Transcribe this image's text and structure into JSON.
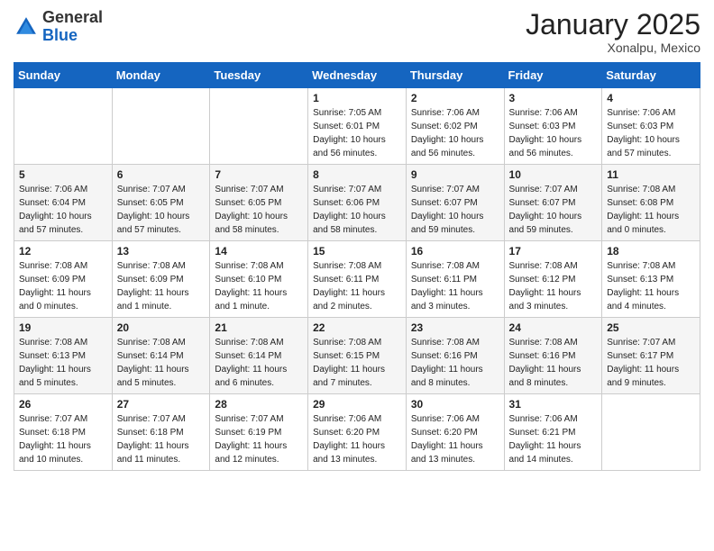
{
  "header": {
    "logo": {
      "line1": "General",
      "line2": "Blue"
    },
    "month": "January 2025",
    "location": "Xonalpu, Mexico"
  },
  "weekdays": [
    "Sunday",
    "Monday",
    "Tuesday",
    "Wednesday",
    "Thursday",
    "Friday",
    "Saturday"
  ],
  "weeks": [
    [
      {
        "day": "",
        "info": ""
      },
      {
        "day": "",
        "info": ""
      },
      {
        "day": "",
        "info": ""
      },
      {
        "day": "1",
        "info": "Sunrise: 7:05 AM\nSunset: 6:01 PM\nDaylight: 10 hours\nand 56 minutes."
      },
      {
        "day": "2",
        "info": "Sunrise: 7:06 AM\nSunset: 6:02 PM\nDaylight: 10 hours\nand 56 minutes."
      },
      {
        "day": "3",
        "info": "Sunrise: 7:06 AM\nSunset: 6:03 PM\nDaylight: 10 hours\nand 56 minutes."
      },
      {
        "day": "4",
        "info": "Sunrise: 7:06 AM\nSunset: 6:03 PM\nDaylight: 10 hours\nand 57 minutes."
      }
    ],
    [
      {
        "day": "5",
        "info": "Sunrise: 7:06 AM\nSunset: 6:04 PM\nDaylight: 10 hours\nand 57 minutes."
      },
      {
        "day": "6",
        "info": "Sunrise: 7:07 AM\nSunset: 6:05 PM\nDaylight: 10 hours\nand 57 minutes."
      },
      {
        "day": "7",
        "info": "Sunrise: 7:07 AM\nSunset: 6:05 PM\nDaylight: 10 hours\nand 58 minutes."
      },
      {
        "day": "8",
        "info": "Sunrise: 7:07 AM\nSunset: 6:06 PM\nDaylight: 10 hours\nand 58 minutes."
      },
      {
        "day": "9",
        "info": "Sunrise: 7:07 AM\nSunset: 6:07 PM\nDaylight: 10 hours\nand 59 minutes."
      },
      {
        "day": "10",
        "info": "Sunrise: 7:07 AM\nSunset: 6:07 PM\nDaylight: 10 hours\nand 59 minutes."
      },
      {
        "day": "11",
        "info": "Sunrise: 7:08 AM\nSunset: 6:08 PM\nDaylight: 11 hours\nand 0 minutes."
      }
    ],
    [
      {
        "day": "12",
        "info": "Sunrise: 7:08 AM\nSunset: 6:09 PM\nDaylight: 11 hours\nand 0 minutes."
      },
      {
        "day": "13",
        "info": "Sunrise: 7:08 AM\nSunset: 6:09 PM\nDaylight: 11 hours\nand 1 minute."
      },
      {
        "day": "14",
        "info": "Sunrise: 7:08 AM\nSunset: 6:10 PM\nDaylight: 11 hours\nand 1 minute."
      },
      {
        "day": "15",
        "info": "Sunrise: 7:08 AM\nSunset: 6:11 PM\nDaylight: 11 hours\nand 2 minutes."
      },
      {
        "day": "16",
        "info": "Sunrise: 7:08 AM\nSunset: 6:11 PM\nDaylight: 11 hours\nand 3 minutes."
      },
      {
        "day": "17",
        "info": "Sunrise: 7:08 AM\nSunset: 6:12 PM\nDaylight: 11 hours\nand 3 minutes."
      },
      {
        "day": "18",
        "info": "Sunrise: 7:08 AM\nSunset: 6:13 PM\nDaylight: 11 hours\nand 4 minutes."
      }
    ],
    [
      {
        "day": "19",
        "info": "Sunrise: 7:08 AM\nSunset: 6:13 PM\nDaylight: 11 hours\nand 5 minutes."
      },
      {
        "day": "20",
        "info": "Sunrise: 7:08 AM\nSunset: 6:14 PM\nDaylight: 11 hours\nand 5 minutes."
      },
      {
        "day": "21",
        "info": "Sunrise: 7:08 AM\nSunset: 6:14 PM\nDaylight: 11 hours\nand 6 minutes."
      },
      {
        "day": "22",
        "info": "Sunrise: 7:08 AM\nSunset: 6:15 PM\nDaylight: 11 hours\nand 7 minutes."
      },
      {
        "day": "23",
        "info": "Sunrise: 7:08 AM\nSunset: 6:16 PM\nDaylight: 11 hours\nand 8 minutes."
      },
      {
        "day": "24",
        "info": "Sunrise: 7:08 AM\nSunset: 6:16 PM\nDaylight: 11 hours\nand 8 minutes."
      },
      {
        "day": "25",
        "info": "Sunrise: 7:07 AM\nSunset: 6:17 PM\nDaylight: 11 hours\nand 9 minutes."
      }
    ],
    [
      {
        "day": "26",
        "info": "Sunrise: 7:07 AM\nSunset: 6:18 PM\nDaylight: 11 hours\nand 10 minutes."
      },
      {
        "day": "27",
        "info": "Sunrise: 7:07 AM\nSunset: 6:18 PM\nDaylight: 11 hours\nand 11 minutes."
      },
      {
        "day": "28",
        "info": "Sunrise: 7:07 AM\nSunset: 6:19 PM\nDaylight: 11 hours\nand 12 minutes."
      },
      {
        "day": "29",
        "info": "Sunrise: 7:06 AM\nSunset: 6:20 PM\nDaylight: 11 hours\nand 13 minutes."
      },
      {
        "day": "30",
        "info": "Sunrise: 7:06 AM\nSunset: 6:20 PM\nDaylight: 11 hours\nand 13 minutes."
      },
      {
        "day": "31",
        "info": "Sunrise: 7:06 AM\nSunset: 6:21 PM\nDaylight: 11 hours\nand 14 minutes."
      },
      {
        "day": "",
        "info": ""
      }
    ]
  ]
}
